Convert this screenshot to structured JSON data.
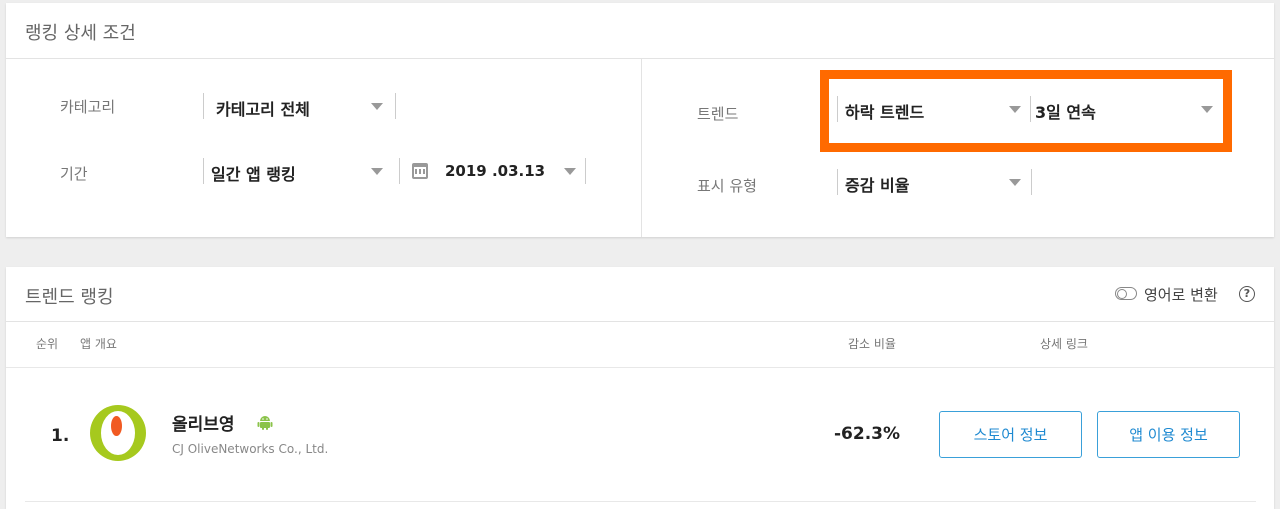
{
  "filter": {
    "title": "랭킹 상세 조건",
    "category": {
      "label": "카테고리",
      "value": "카테고리 전체"
    },
    "period": {
      "label": "기간",
      "value": "일간 앱 랭킹",
      "date": "2019 .03.13"
    },
    "trend": {
      "label": "트렌드",
      "value": "하락 트렌드",
      "duration": "3일 연속"
    },
    "display": {
      "label": "표시 유형",
      "value": "증감 비율"
    },
    "highlight_color": "#ff6a00"
  },
  "ranking": {
    "title": "트렌드 랭킹",
    "translate_label": "영어로 변환",
    "help_glyph": "?",
    "columns": {
      "rank": "순위",
      "overview": "앱 개요",
      "ratio": "감소 비율",
      "links": "상세 링크"
    },
    "rows": [
      {
        "rank": "1.",
        "name": "올리브영",
        "platform_icon": "android-icon",
        "company": "CJ OliveNetworks Co., Ltd.",
        "ratio": "-62.3%",
        "store_button": "스토어 정보",
        "usage_button": "앱 이용 정보"
      }
    ]
  },
  "colors": {
    "accent": "#1f8ad1",
    "logo_green": "#a6c91e",
    "logo_orange": "#f15a22",
    "android_green": "#8bc34a"
  }
}
